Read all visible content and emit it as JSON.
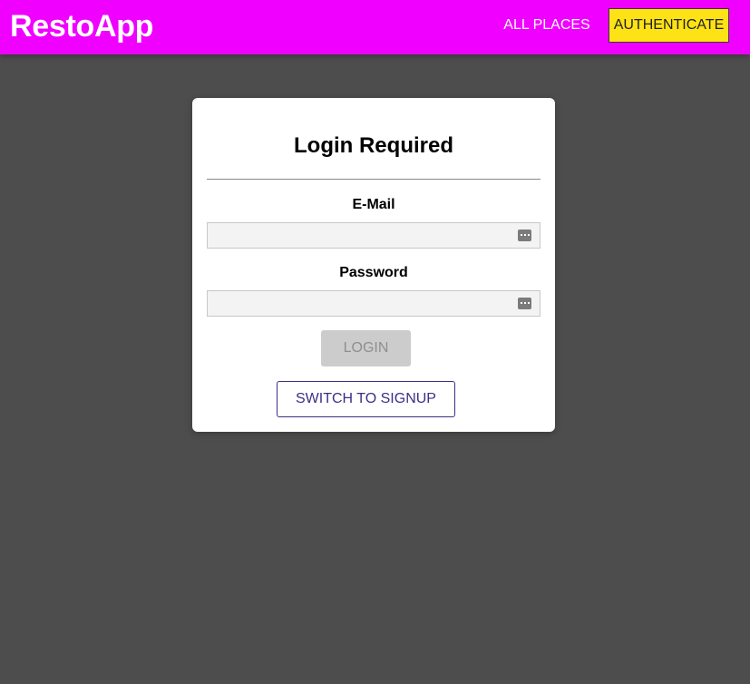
{
  "header": {
    "brand": "RestoApp",
    "nav": {
      "all_places": "ALL PLACES",
      "authenticate": "AUTHENTICATE"
    }
  },
  "login_card": {
    "title": "Login Required",
    "email": {
      "label": "E-Mail",
      "value": "",
      "placeholder": ""
    },
    "password": {
      "label": "Password",
      "value": "",
      "placeholder": ""
    },
    "login_button": "LOGIN",
    "switch_button": "SWITCH TO SIGNUP"
  },
  "icons": {
    "email_field": "password-manager-key-icon",
    "password_field": "password-manager-key-icon"
  },
  "colors": {
    "header_bg": "#ef00ff",
    "page_bg": "#4d4d4d",
    "auth_button_bg": "#fde216",
    "switch_button_accent": "#3d2f85",
    "login_button_disabled_bg": "#cccccc"
  }
}
